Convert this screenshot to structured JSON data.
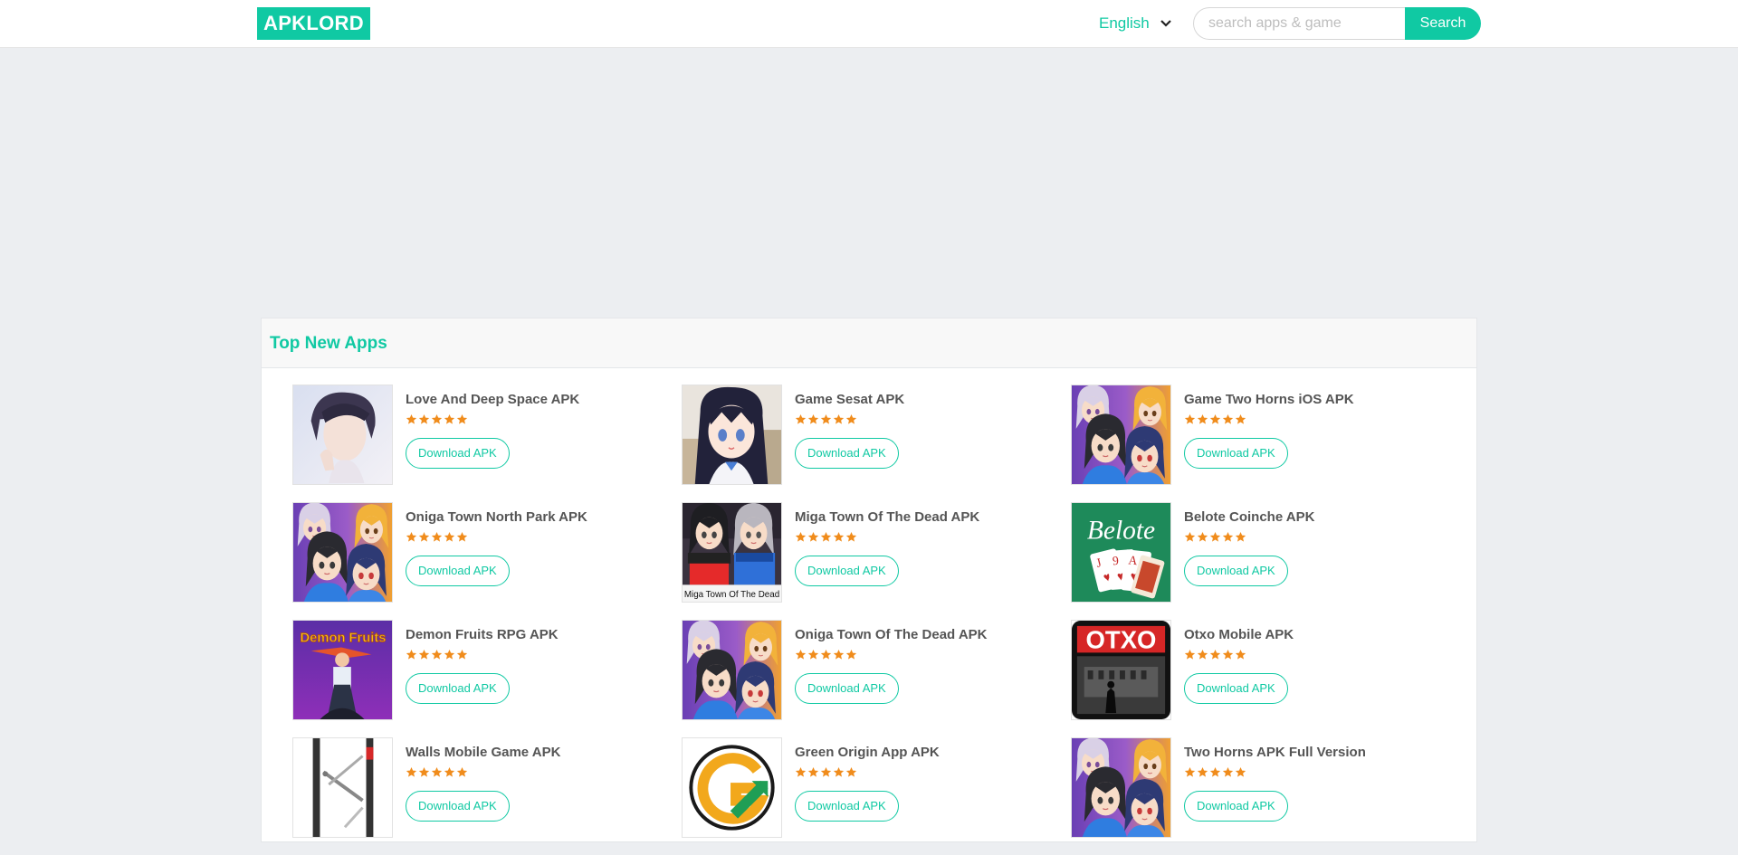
{
  "header": {
    "logo": "APKLORD",
    "language": "English",
    "search_placeholder": "search apps & game",
    "search_button": "Search"
  },
  "section": {
    "title": "Top New Apps"
  },
  "colors": {
    "accent": "#10c9a3",
    "star": "#f08c1c",
    "background": "#eceef1"
  },
  "apps": [
    {
      "name": "Love And Deep Space APK",
      "rating": 5,
      "button": "Download APK",
      "icon": "portrait-icon"
    },
    {
      "name": "Game Sesat APK",
      "rating": 5,
      "button": "Download APK",
      "icon": "anime-girl-icon"
    },
    {
      "name": "Game Two Horns iOS APK",
      "rating": 5,
      "button": "Download APK",
      "icon": "anime-group-icon"
    },
    {
      "name": "Oniga Town North Park APK",
      "rating": 5,
      "button": "Download APK",
      "icon": "anime-group-icon"
    },
    {
      "name": "Miga Town Of The Dead APK",
      "rating": 5,
      "button": "Download APK",
      "icon": "anime-duo-icon"
    },
    {
      "name": "Belote Coinche APK",
      "rating": 5,
      "button": "Download APK",
      "icon": "card-game-icon"
    },
    {
      "name": "Demon Fruits RPG APK",
      "rating": 5,
      "button": "Download APK",
      "icon": "demon-fruits-icon"
    },
    {
      "name": "Oniga Town Of The Dead APK",
      "rating": 5,
      "button": "Download APK",
      "icon": "anime-group-icon"
    },
    {
      "name": "Otxo Mobile APK",
      "rating": 5,
      "button": "Download APK",
      "icon": "otxo-icon"
    },
    {
      "name": "Walls Mobile Game APK",
      "rating": 5,
      "button": "Download APK",
      "icon": "walls-icon"
    },
    {
      "name": "Green Origin App APK",
      "rating": 5,
      "button": "Download APK",
      "icon": "g-logo-icon"
    },
    {
      "name": "Two Horns APK Full Version",
      "rating": 5,
      "button": "Download APK",
      "icon": "anime-group-icon"
    }
  ],
  "thumb_text": {
    "belote": "Belote",
    "demon_fruits": "Demon Fruits",
    "otxo": "OTXO",
    "miga": "Miga Town Of The Dead"
  }
}
